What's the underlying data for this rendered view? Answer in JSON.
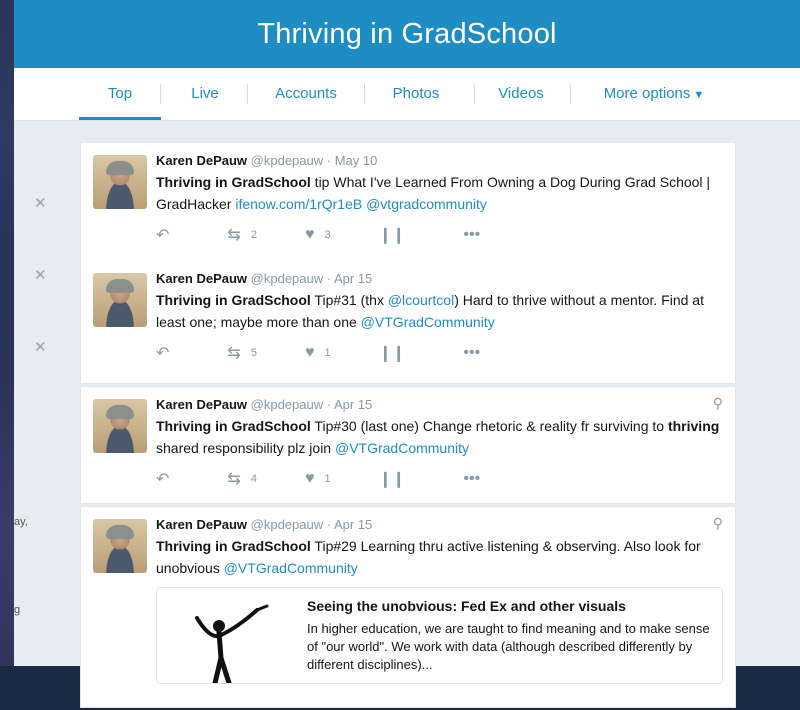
{
  "header": {
    "title": "Thriving in GradSchool"
  },
  "tabs": [
    {
      "label": "Top"
    },
    {
      "label": "Live"
    },
    {
      "label": "Accounts"
    },
    {
      "label": "Photos"
    },
    {
      "label": "Videos"
    },
    {
      "label": "More options"
    }
  ],
  "sidebar_fragments": {
    "a": "ay,",
    "b": "g"
  },
  "tweets": [
    {
      "name": "Karen DePauw",
      "handle": "@kpdepauw",
      "date": "May 10",
      "text_bold": "Thriving in GradSchool",
      "text": " tip What I've Learned From Owning a Dog During Grad School | GradHacker ",
      "link1": "ifenow.com/1rQr1eB",
      "link2": " @vtgradcommunity",
      "retweets": "2",
      "likes": "3"
    },
    {
      "name": "Karen DePauw",
      "handle": "@kpdepauw",
      "date": "Apr 15",
      "text_bold": "Thriving in GradSchool",
      "text_pre": " Tip#31 (thx ",
      "mention": "@lcourtcol",
      "text_post": ") Hard to thrive without a mentor. Find at least one; maybe more than one ",
      "link": "@VTGradCommunity",
      "retweets": "5",
      "likes": "1"
    },
    {
      "name": "Karen DePauw",
      "handle": "@kpdepauw",
      "date": "Apr 15",
      "text_bold": "Thriving in GradSchool",
      "text": " Tip#30 (last one) Change rhetoric & reality fr surviving to ",
      "text_bold2": "thriving",
      "text2": " shared responsibility plz join ",
      "link": "@VTGradCommunity",
      "retweets": "4",
      "likes": "1"
    },
    {
      "name": "Karen DePauw",
      "handle": "@kpdepauw",
      "date": "Apr 15",
      "text_bold": "Thriving in GradSchool",
      "text": " Tip#29 Learning thru active listening & observing. Also look for unobvious ",
      "link": "@VTGradCommunity",
      "card_title": "Seeing the unobvious: Fed Ex and other visuals",
      "card_desc": "In higher education, we are taught to find meaning and to make sense of \"our world\". We work with data (although described differently by different disciplines)..."
    }
  ],
  "colors": {
    "brand": "#1d8dc3",
    "text": "#14171a",
    "muted": "#8899a6"
  }
}
